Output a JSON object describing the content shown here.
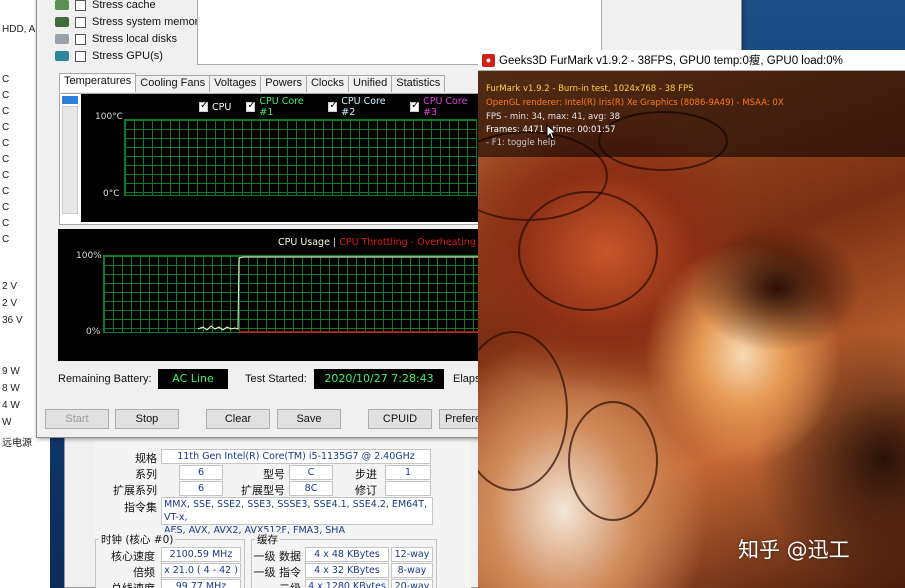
{
  "left_window": {
    "labels": [
      "HDD, A",
      "C",
      "C",
      "C",
      "C",
      "C",
      "C",
      "C",
      "C",
      "C",
      "C",
      "C",
      "2 V",
      "2 V",
      "36 V",
      "9 W",
      "8 W",
      "4 W",
      "W",
      "远电源"
    ]
  },
  "aida": {
    "options": [
      {
        "label": "Stress cache",
        "icon": "cache-icon"
      },
      {
        "label": "Stress system memory",
        "icon": "memory-icon"
      },
      {
        "label": "Stress local disks",
        "icon": "disk-icon"
      },
      {
        "label": "Stress GPU(s)",
        "icon": "gpu-icon"
      }
    ],
    "tabs": [
      "Temperatures",
      "Cooling Fans",
      "Voltages",
      "Powers",
      "Clocks",
      "Unified",
      "Statistics"
    ],
    "temp_legend": [
      {
        "label": "CPU",
        "color": "#ffffff"
      },
      {
        "label": "CPU Core #1",
        "color": "#3cf16a"
      },
      {
        "label": "CPU Core #2",
        "color": "#c8f8ff"
      },
      {
        "label": "CPU Core #3",
        "color": "#e040e0"
      }
    ],
    "temp_axis": {
      "top": "100°C",
      "bottom": "0°C"
    },
    "cpu_chart": {
      "title_usage": "CPU Usage",
      "separator": "|",
      "title_throttle": "CPU Throttling - Overheating Dete",
      "usage_color": "#ffffdd",
      "throttle_color": "#e01818",
      "axis_top": "100%",
      "axis_bottom": "0%"
    },
    "status": {
      "battery_label": "Remaining Battery:",
      "battery_value": "AC Line",
      "started_label": "Test Started:",
      "started_value": "2020/10/27 7:28:43",
      "elapsed_label": "Elapse"
    },
    "buttons": {
      "start": "Start",
      "stop": "Stop",
      "clear": "Clear",
      "save": "Save",
      "cpuid": "CPUID",
      "preferences": "Prefere"
    }
  },
  "cpuz": {
    "spec_label": "规格",
    "spec_value": "11th Gen Intel(R) Core(TM) i5-1135G7 @ 2.40GHz",
    "family_label": "系列",
    "family_value": "6",
    "model_label": "型号",
    "model_value": "C",
    "stepping_label": "步进",
    "stepping_value": "1",
    "ext_family_label": "扩展系列",
    "ext_family_value": "6",
    "ext_model_label": "扩展型号",
    "ext_model_value": "8C",
    "revision_label": "修订",
    "revision_value": "",
    "instr_label": "指令集",
    "instr_value_1": "MMX, SSE, SSE2, SSE3, SSSE3, SSE4.1, SSE4.2, EM64T, VT-x,",
    "instr_value_2": "AES, AVX, AVX2, AVX512F, FMA3, SHA",
    "clocks_title": "时钟 (核心 #0)",
    "core_speed_label": "核心速度",
    "core_speed_value": "2100.59 MHz",
    "multiplier_label": "倍频",
    "multiplier_value": "x 21.0 ( 4 - 42 )",
    "bus_label": "总线速度",
    "bus_value": "99.77 MHz",
    "cache_title": "缓存",
    "l1d_label": "一级 数据",
    "l1d_value": "4 x 48 KBytes",
    "l1d_way": "12-way",
    "l1i_label": "一级 指令",
    "l1i_value": "4 x 32 KBytes",
    "l1i_way": "8-way",
    "l2_label": "二级",
    "l2_value": "4 x 1280 KBytes",
    "l2_way": "20-way"
  },
  "furmark": {
    "title": "Geeks3D FurMark v1.9.2 - 38FPS, GPU0 temp:0瘦, GPU0 load:0%",
    "hud": [
      {
        "text": "FurMark v1.9.2 - Burn-in test, 1024x768 - 38 FPS",
        "color": "#ffd23c"
      },
      {
        "text": "OpenGL renderer: Intel(R) Iris(R) Xe Graphics (8086-9A49) - MSAA: 0X",
        "color": "#ff7a1a"
      },
      {
        "text": "FPS - min: 34, max: 41, avg: 38",
        "color": "#e6e6e6"
      },
      {
        "text": "Frames: 4471 - time: 00:01:57",
        "color": "#ffffff"
      },
      {
        "text": "- F1: toggle help",
        "color": "#c8c8c8"
      }
    ]
  },
  "watermark": "知乎 @迅工"
}
